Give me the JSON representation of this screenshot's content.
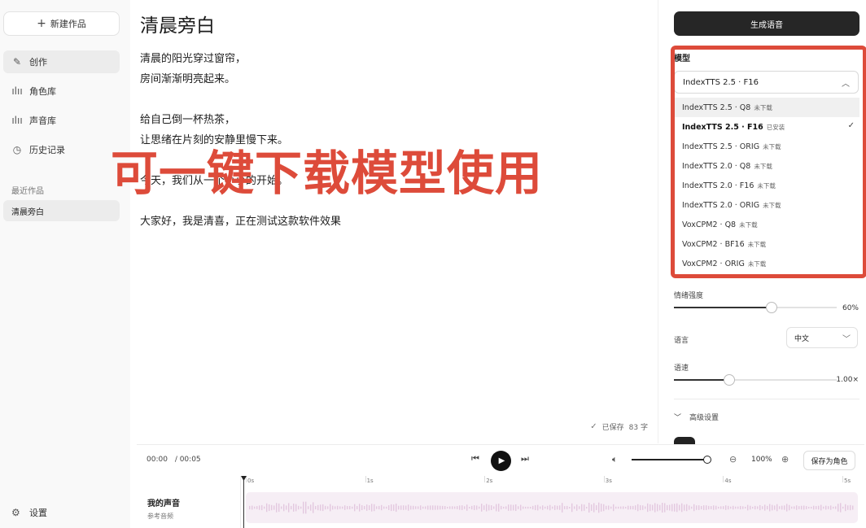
{
  "sidebar": {
    "new_work": "新建作品",
    "nav": [
      {
        "label": "创作",
        "icon": "pencil-icon",
        "active": true
      },
      {
        "label": "角色库",
        "icon": "waveform-icon",
        "active": false
      },
      {
        "label": "声音库",
        "icon": "waveform-icon",
        "active": false
      },
      {
        "label": "历史记录",
        "icon": "clock-icon",
        "active": false
      }
    ],
    "recent_label": "最近作品",
    "recent_item": "清晨旁白",
    "settings": "设置"
  },
  "editor": {
    "title": "清晨旁白",
    "lines": [
      "清晨的阳光穿过窗帘，",
      "房间渐渐明亮起来。",
      "",
      "给自己倒一杯热茶，",
      "让思绪在片刻的安静里慢下来。",
      "",
      "今天，我们从一个小小的开始。",
      "",
      "大家好，我是清喜，正在测试这款软件效果"
    ],
    "save_status": "已保存",
    "char_count": "83 字"
  },
  "panel": {
    "generate": "生成语音",
    "model_label": "模型",
    "model_selected": "IndexTTS 2.5 · F16",
    "models": [
      {
        "name": "IndexTTS 2.5 · Q8",
        "status": "未下载",
        "selected": false,
        "hover": true
      },
      {
        "name": "IndexTTS 2.5 · F16",
        "status": "已安装",
        "selected": true,
        "hover": false
      },
      {
        "name": "IndexTTS 2.5 · ORIG",
        "status": "未下载",
        "selected": false,
        "hover": false
      },
      {
        "name": "IndexTTS 2.0 · Q8",
        "status": "未下载",
        "selected": false,
        "hover": false
      },
      {
        "name": "IndexTTS 2.0 · F16",
        "status": "未下载",
        "selected": false,
        "hover": false
      },
      {
        "name": "IndexTTS 2.0 · ORIG",
        "status": "未下载",
        "selected": false,
        "hover": false
      },
      {
        "name": "VoxCPM2 · Q8",
        "status": "未下载",
        "selected": false,
        "hover": false
      },
      {
        "name": "VoxCPM2 · BF16",
        "status": "未下载",
        "selected": false,
        "hover": false
      },
      {
        "name": "VoxCPM2 · ORIG",
        "status": "未下载",
        "selected": false,
        "hover": false
      }
    ],
    "emotion_label": "情绪强度",
    "emotion_value": "60%",
    "emotion_fraction": 0.6,
    "language_label": "语言",
    "language_value": "中文",
    "speed_label": "语速",
    "speed_value": "1.00×",
    "speed_fraction": 0.34,
    "advanced": "高级设置"
  },
  "player": {
    "current": "00:00",
    "total": "/ 00:05",
    "zoom": "100%",
    "save_role": "保存为角色",
    "volume_fraction": 1.0
  },
  "track": {
    "name": "我的声音",
    "sub": "参考音频",
    "ticks": [
      "0s",
      "1s",
      "2s",
      "3s",
      "4s",
      "5s"
    ]
  },
  "overlay": {
    "promo": "可一键下载模型使用"
  },
  "colors": {
    "accent_red": "#dd4b3a",
    "dark": "#262626",
    "wave": "#f6eef5"
  }
}
